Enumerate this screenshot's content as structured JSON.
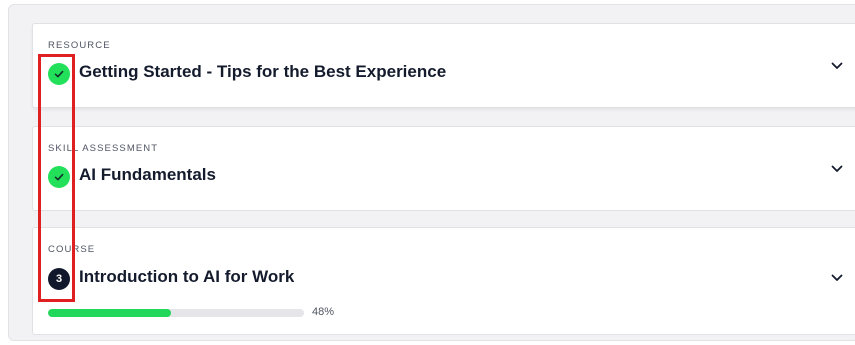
{
  "items": [
    {
      "type_label": "RESOURCE",
      "title": "Getting Started - Tips for the Best Experience",
      "status": "complete",
      "status_icon": "check-icon"
    },
    {
      "type_label": "SKILL ASSESSMENT",
      "title": "AI Fundamentals",
      "status": "complete",
      "status_icon": "check-icon"
    },
    {
      "type_label": "COURSE",
      "title": "Introduction to AI for Work",
      "status": "in-progress",
      "step_number": "3",
      "progress_percent": 48,
      "progress_label": "48%"
    }
  ],
  "colors": {
    "complete_green": "#22e05a",
    "step_badge": "#12182b",
    "progress_fill": "#21d85a",
    "progress_track": "#e5e5ea",
    "highlight_box": "#e02020"
  }
}
